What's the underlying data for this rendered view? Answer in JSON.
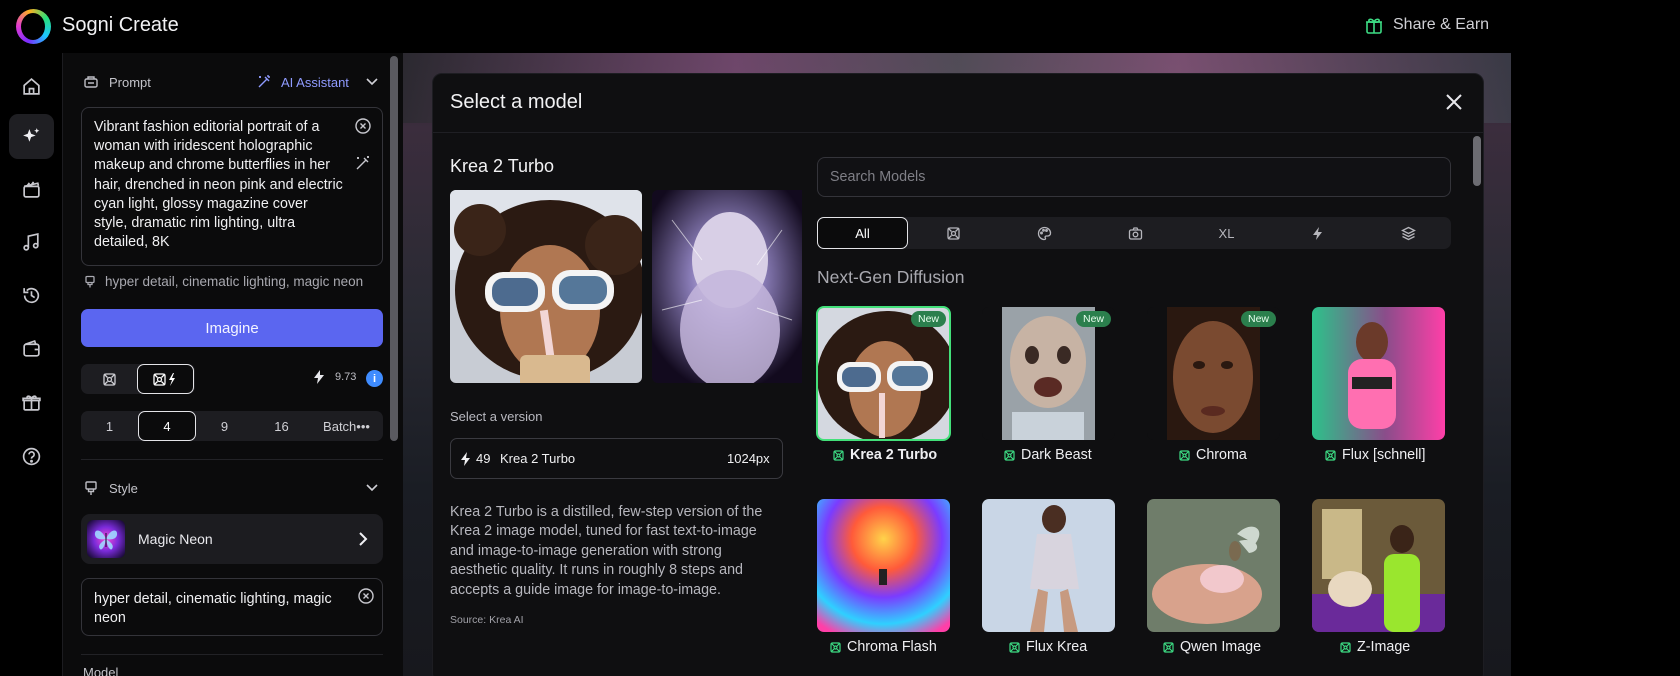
{
  "app": {
    "title": "Sogni Create",
    "share_label": "Share & Earn"
  },
  "rail": {
    "items": [
      "home-icon",
      "sparkle-icon",
      "clapper-icon",
      "music-note-icon",
      "history-icon",
      "wallet-icon",
      "gift-icon",
      "help-icon"
    ],
    "active": "sparkle-icon"
  },
  "prompt": {
    "label": "Prompt",
    "assistant_label": "AI Assistant",
    "text": "Vibrant fashion editorial portrait of a woman with iridescent holographic makeup and chrome butterflies in her hair, drenched in neon pink and electric cyan light, glossy magazine cover style, dramatic rim lighting, ultra detailed, 8K",
    "negative_preview": "hyper detail, cinematic lighting, magic neon"
  },
  "imagine": {
    "label": "Imagine"
  },
  "cost": {
    "value": "9.73",
    "info": "i"
  },
  "batch": {
    "options": [
      "1",
      "4",
      "9",
      "16"
    ],
    "selected": "4",
    "more_label": "Batch•••"
  },
  "style": {
    "label": "Style",
    "name": "Magic Neon",
    "text": "hyper detail, cinematic lighting, magic neon"
  },
  "models_peek": "Model",
  "modal": {
    "title": "Select a model",
    "detail": {
      "title": "Krea 2 Turbo",
      "version_label": "Select a version",
      "version": {
        "steps": "49",
        "name": "Krea 2 Turbo",
        "resolution": "1024px"
      },
      "description": "Krea 2 Turbo is a distilled, few-step version of the Krea 2 image model, tuned for fast text-to-image and image-to-image generation with strong aesthetic quality. It runs in roughly 8 steps and accepts a guide image for image-to-image.",
      "source": "Source: Krea AI"
    },
    "search_placeholder": "Search Models",
    "filters": [
      "All",
      "network-icon",
      "palette-icon",
      "camera-icon",
      "XL",
      "lightning-icon",
      "layers-icon"
    ],
    "group_title": "Next-Gen Diffusion",
    "models": [
      {
        "name": "Krea 2 Turbo",
        "badge": "New",
        "selected": true
      },
      {
        "name": "Dark Beast",
        "badge": "New"
      },
      {
        "name": "Chroma",
        "badge": "New"
      },
      {
        "name": "Flux [schnell]"
      },
      {
        "name": "Chroma Flash"
      },
      {
        "name": "Flux Krea"
      },
      {
        "name": "Qwen Image"
      },
      {
        "name": "Z-Image"
      }
    ]
  },
  "colors": {
    "accent": "#5b66f0",
    "selected_outline": "#43e07a",
    "badge_bg": "#2b7f4d",
    "assistant": "#8f9bff"
  }
}
